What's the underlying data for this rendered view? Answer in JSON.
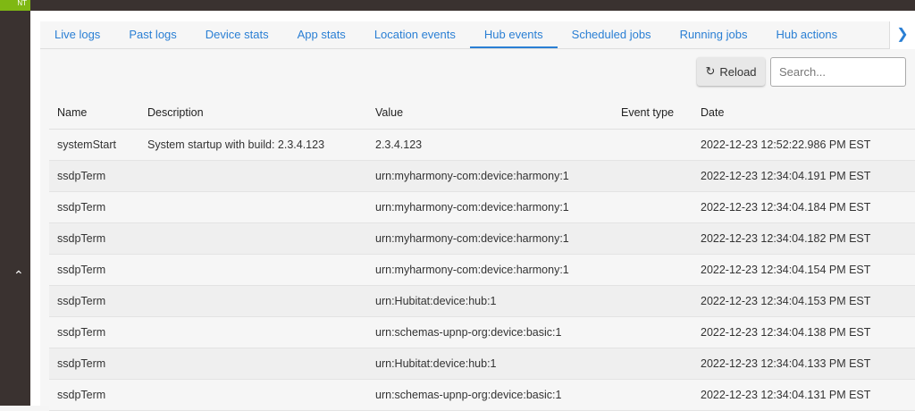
{
  "brand": "NT",
  "tabs": [
    "Live logs",
    "Past logs",
    "Device stats",
    "App stats",
    "Location events",
    "Hub events",
    "Scheduled jobs",
    "Running jobs",
    "Hub actions"
  ],
  "active_tab": "Hub events",
  "toolbar": {
    "reload_label": "Reload",
    "search_placeholder": "Search..."
  },
  "table": {
    "columns": [
      "Name",
      "Description",
      "Value",
      "Event type",
      "Date"
    ],
    "rows": [
      [
        "systemStart",
        "System startup with build: 2.3.4.123",
        "2.3.4.123",
        "",
        "2022-12-23 12:52:22.986 PM EST"
      ],
      [
        "ssdpTerm",
        "",
        "urn:myharmony-com:device:harmony:1",
        "",
        "2022-12-23 12:34:04.191 PM EST"
      ],
      [
        "ssdpTerm",
        "",
        "urn:myharmony-com:device:harmony:1",
        "",
        "2022-12-23 12:34:04.184 PM EST"
      ],
      [
        "ssdpTerm",
        "",
        "urn:myharmony-com:device:harmony:1",
        "",
        "2022-12-23 12:34:04.182 PM EST"
      ],
      [
        "ssdpTerm",
        "",
        "urn:myharmony-com:device:harmony:1",
        "",
        "2022-12-23 12:34:04.154 PM EST"
      ],
      [
        "ssdpTerm",
        "",
        "urn:Hubitat:device:hub:1",
        "",
        "2022-12-23 12:34:04.153 PM EST"
      ],
      [
        "ssdpTerm",
        "",
        "urn:schemas-upnp-org:device:basic:1",
        "",
        "2022-12-23 12:34:04.138 PM EST"
      ],
      [
        "ssdpTerm",
        "",
        "urn:Hubitat:device:hub:1",
        "",
        "2022-12-23 12:34:04.133 PM EST"
      ],
      [
        "ssdpTerm",
        "",
        "urn:schemas-upnp-org:device:basic:1",
        "",
        "2022-12-23 12:34:04.131 PM EST"
      ]
    ]
  }
}
